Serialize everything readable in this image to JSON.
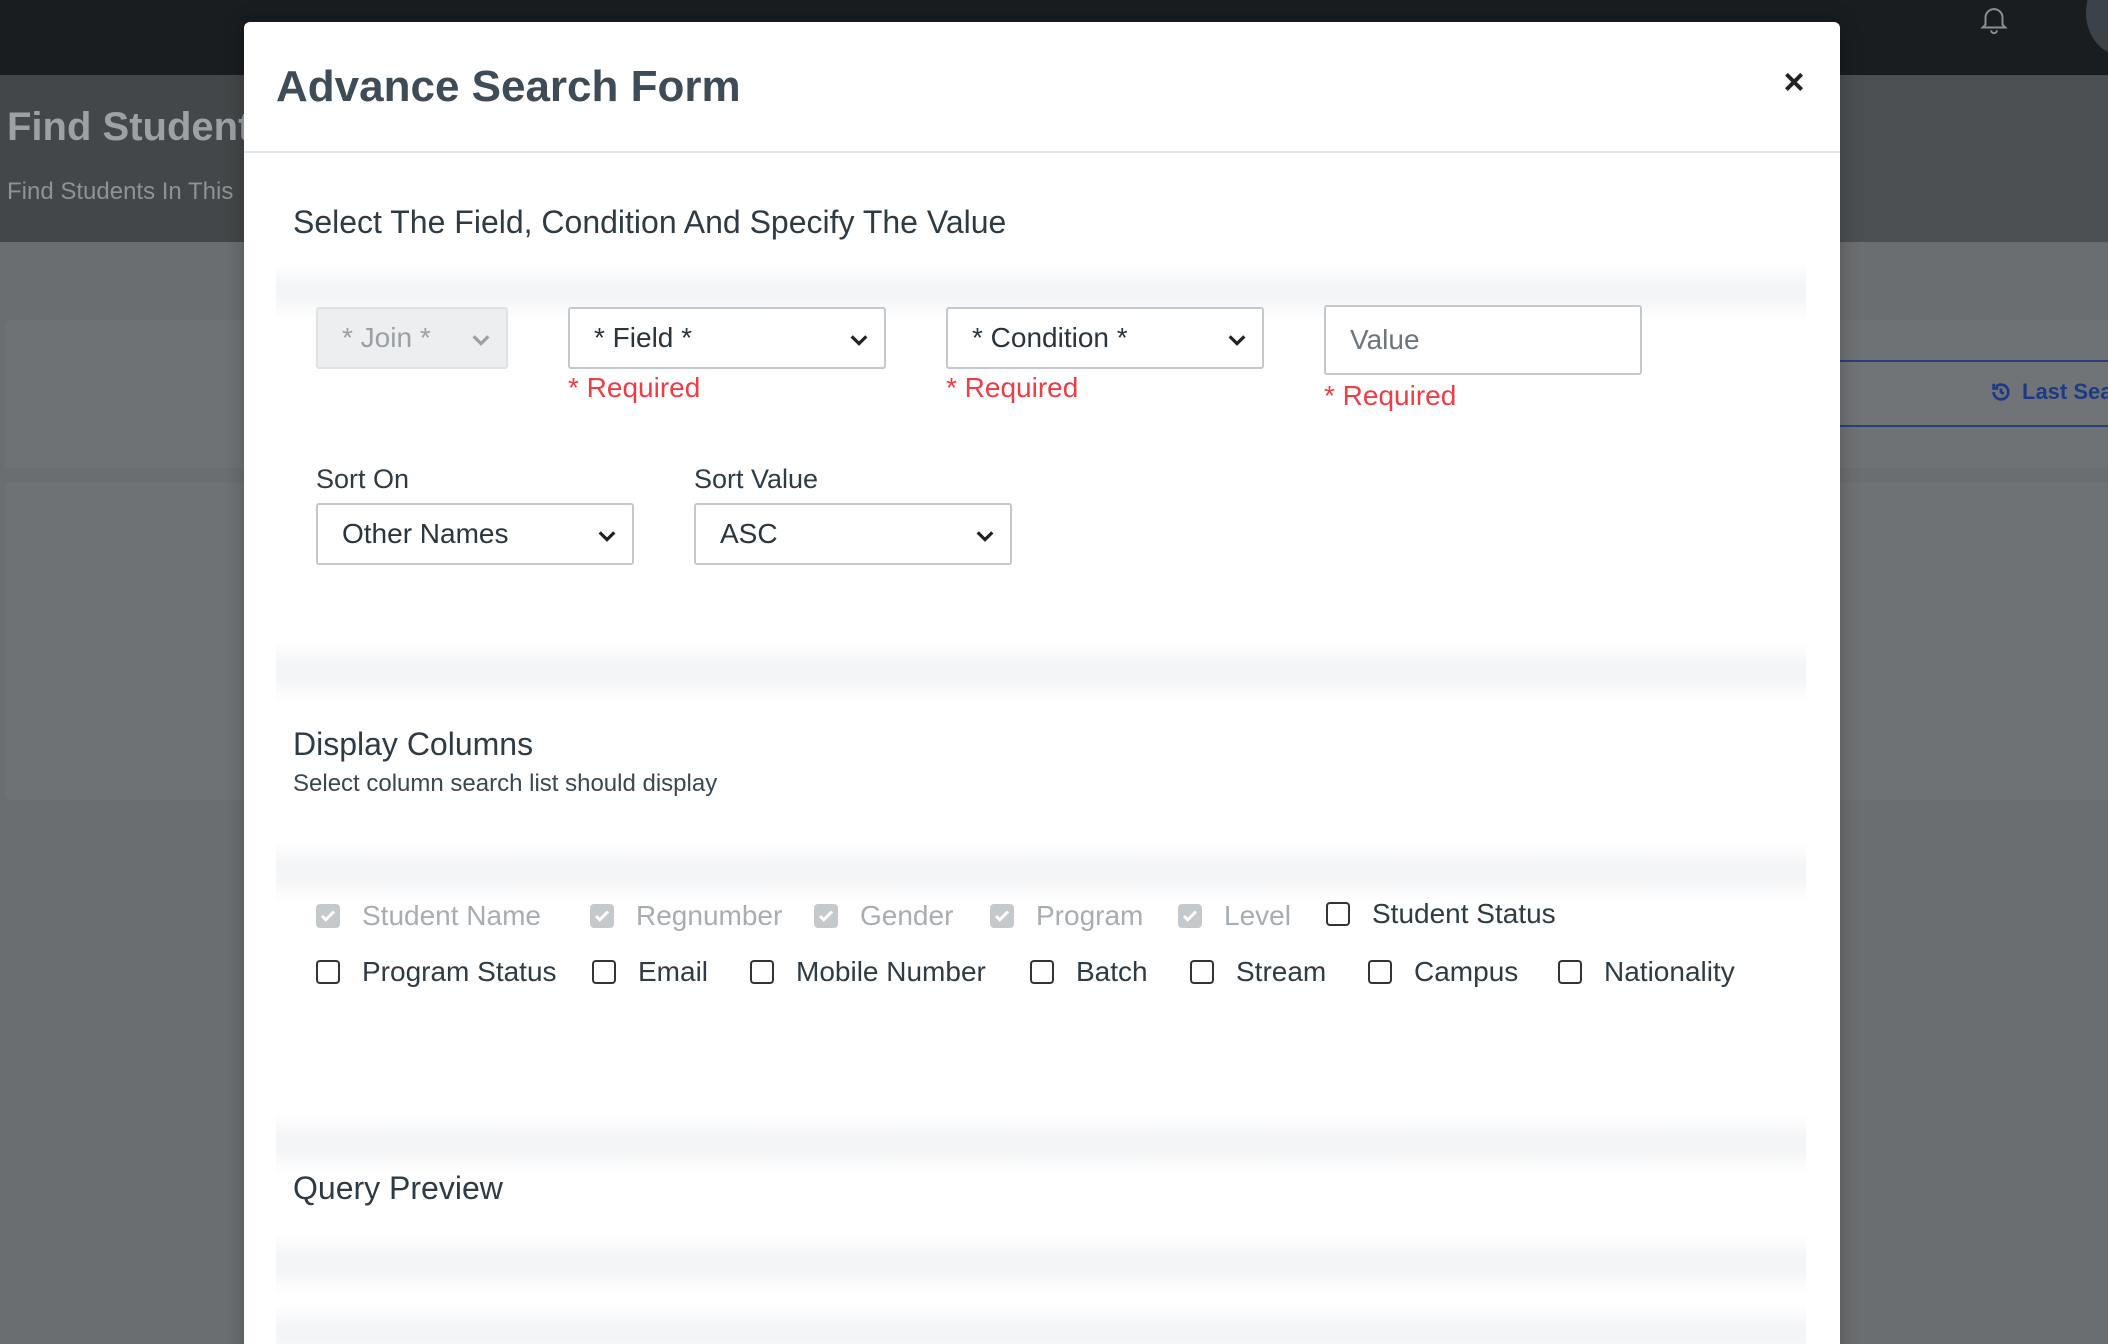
{
  "background": {
    "page_title": "Find Students",
    "page_subtitle": "Find Students In This",
    "last_search_label": "Last Sea",
    "icons": [
      "bell-icon",
      "avatar",
      "history-icon"
    ]
  },
  "modal": {
    "title": "Advance Search Form",
    "close_label": "×",
    "criteria": {
      "section_title": "Select The Field, Condition And Specify The Value",
      "join": {
        "selected": "* Join *",
        "disabled": true
      },
      "field": {
        "selected": "* Field *",
        "required_text": "* Required"
      },
      "condition": {
        "selected": "* Condition *",
        "required_text": "* Required"
      },
      "value": {
        "placeholder": "Value",
        "value": "",
        "required_text": "* Required"
      },
      "sort_on": {
        "label": "Sort On",
        "selected": "Other Names"
      },
      "sort_value": {
        "label": "Sort Value",
        "selected": "ASC"
      }
    },
    "display_columns": {
      "section_title": "Display Columns",
      "description": "Select column search list should display",
      "columns": [
        {
          "label": "Student Name",
          "checked": true,
          "disabled": true
        },
        {
          "label": "Regnumber",
          "checked": true,
          "disabled": true
        },
        {
          "label": "Gender",
          "checked": true,
          "disabled": true
        },
        {
          "label": "Program",
          "checked": true,
          "disabled": true
        },
        {
          "label": "Level",
          "checked": true,
          "disabled": true
        },
        {
          "label": "Student Status",
          "checked": false,
          "disabled": false
        },
        {
          "label": "Program Status",
          "checked": false,
          "disabled": false
        },
        {
          "label": "Email",
          "checked": false,
          "disabled": false
        },
        {
          "label": "Mobile Number",
          "checked": false,
          "disabled": false
        },
        {
          "label": "Batch",
          "checked": false,
          "disabled": false
        },
        {
          "label": "Stream",
          "checked": false,
          "disabled": false
        },
        {
          "label": "Campus",
          "checked": false,
          "disabled": false
        },
        {
          "label": "Nationality",
          "checked": false,
          "disabled": false
        }
      ]
    },
    "query_preview": {
      "section_title": "Query Preview"
    }
  },
  "colors": {
    "required_red": "#ee3d45",
    "topbar": "#191d20",
    "accent_blue": "#1d3a86"
  }
}
